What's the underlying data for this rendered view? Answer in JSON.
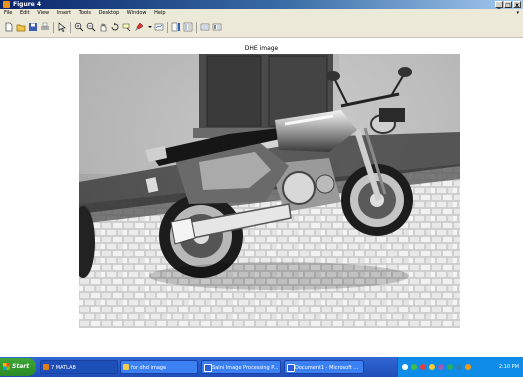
{
  "window": {
    "title": "Figure 4",
    "minimize": "_",
    "maximize": "□",
    "close": "x"
  },
  "menu": {
    "items": [
      "File",
      "Edit",
      "View",
      "Insert",
      "Tools",
      "Desktop",
      "Window",
      "Help"
    ],
    "overflow_arrow": "▾"
  },
  "toolbar": {
    "buttons": [
      "new-figure",
      "open-file",
      "save-figure",
      "print-figure",
      "edit-plot",
      "zoom-in",
      "zoom-out",
      "pan",
      "rotate-3d",
      "data-cursor",
      "brush",
      "link-plot",
      "insert-colorbar",
      "insert-legend",
      "hide-plot-tools",
      "show-plot-tools"
    ]
  },
  "axes": {
    "title": "DHE image"
  },
  "taskbar": {
    "start_label": "Start",
    "tasks": [
      {
        "label": "7 MATLAB",
        "icon_color": "#e07b1a",
        "active": true
      },
      {
        "label": "for dhd image",
        "icon_color": "#f2c94c",
        "active": false
      },
      {
        "label": "Saini Image Processing P...",
        "icon_color": "#2b5fd9",
        "active": false
      },
      {
        "label": "Document1 - Microsoft ...",
        "icon_color": "#2b5fd9",
        "active": false
      }
    ],
    "clock": "2:10 PM"
  },
  "colors": {
    "titlebar": "#0a246a",
    "taskbar": "#245edb",
    "start": "#3da637",
    "tray": "#0f8be8"
  }
}
